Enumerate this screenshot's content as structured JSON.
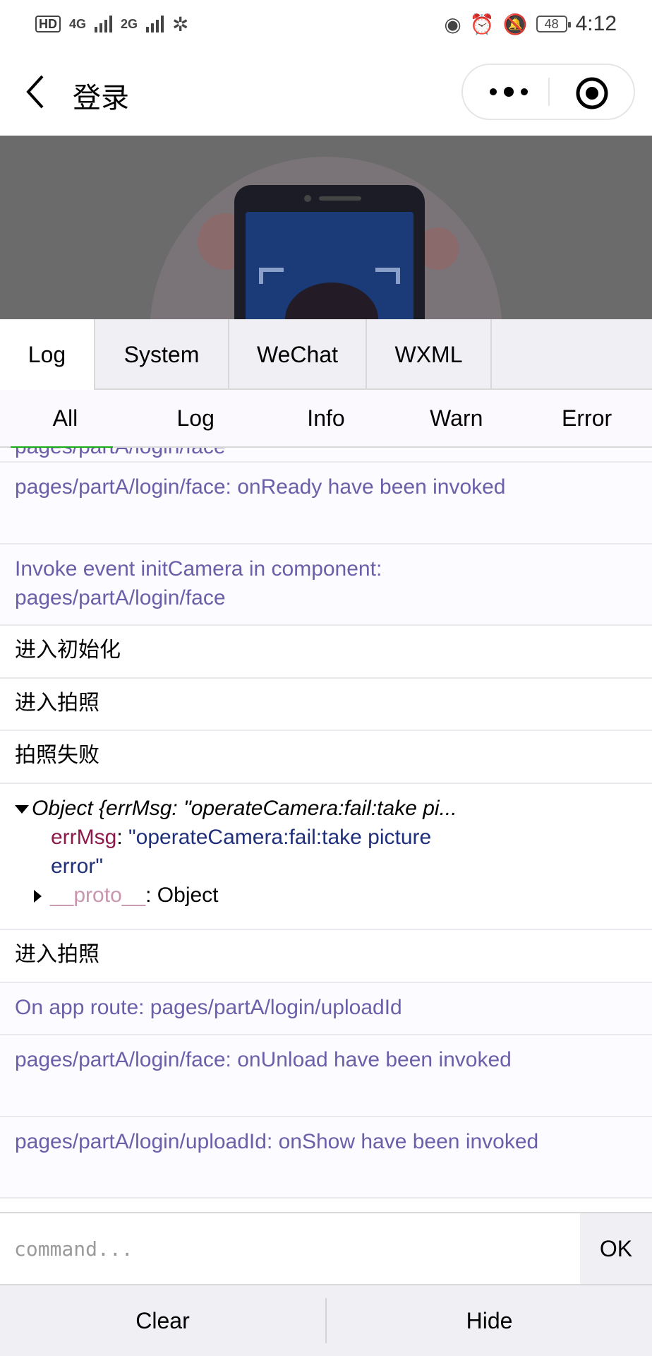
{
  "status_bar": {
    "hd_label": "HD",
    "net1": "4G",
    "net2": "2G",
    "battery": "48",
    "time": "4:12",
    "icons": [
      "eye-icon",
      "alarm-icon",
      "mute-icon"
    ]
  },
  "nav": {
    "title": "登录"
  },
  "console": {
    "tabs": [
      {
        "label": "Log"
      },
      {
        "label": "System"
      },
      {
        "label": "WeChat"
      },
      {
        "label": "WXML"
      }
    ],
    "subtabs": [
      {
        "label": "All"
      },
      {
        "label": "Log"
      },
      {
        "label": "Info"
      },
      {
        "label": "Warn"
      },
      {
        "label": "Error"
      }
    ],
    "logs": {
      "partial": "pages/partA/login/face",
      "row1": "pages/partA/login/face: onReady have been invoked",
      "row2": "Invoke event initCamera in component: pages/partA/login/face",
      "row3": "进入初始化",
      "row4": "进入拍照",
      "row5": "拍照失败",
      "obj_head": "Object {errMsg: \"operateCamera:fail:take pi...",
      "obj_key": "errMsg",
      "obj_value": "\"operateCamera:fail:take picture error\"",
      "obj_proto": "__proto__",
      "obj_proto_value": ": Object",
      "row7": "进入拍照",
      "row8": "On app route: pages/partA/login/uploadId",
      "row9": "pages/partA/login/face: onUnload have been invoked",
      "row10": "pages/partA/login/uploadId: onShow have been invoked"
    },
    "command_placeholder": "command...",
    "ok_label": "OK",
    "clear_label": "Clear",
    "hide_label": "Hide"
  },
  "colors": {
    "system_log": "#6a5fa8",
    "accent": "#1aad19"
  }
}
